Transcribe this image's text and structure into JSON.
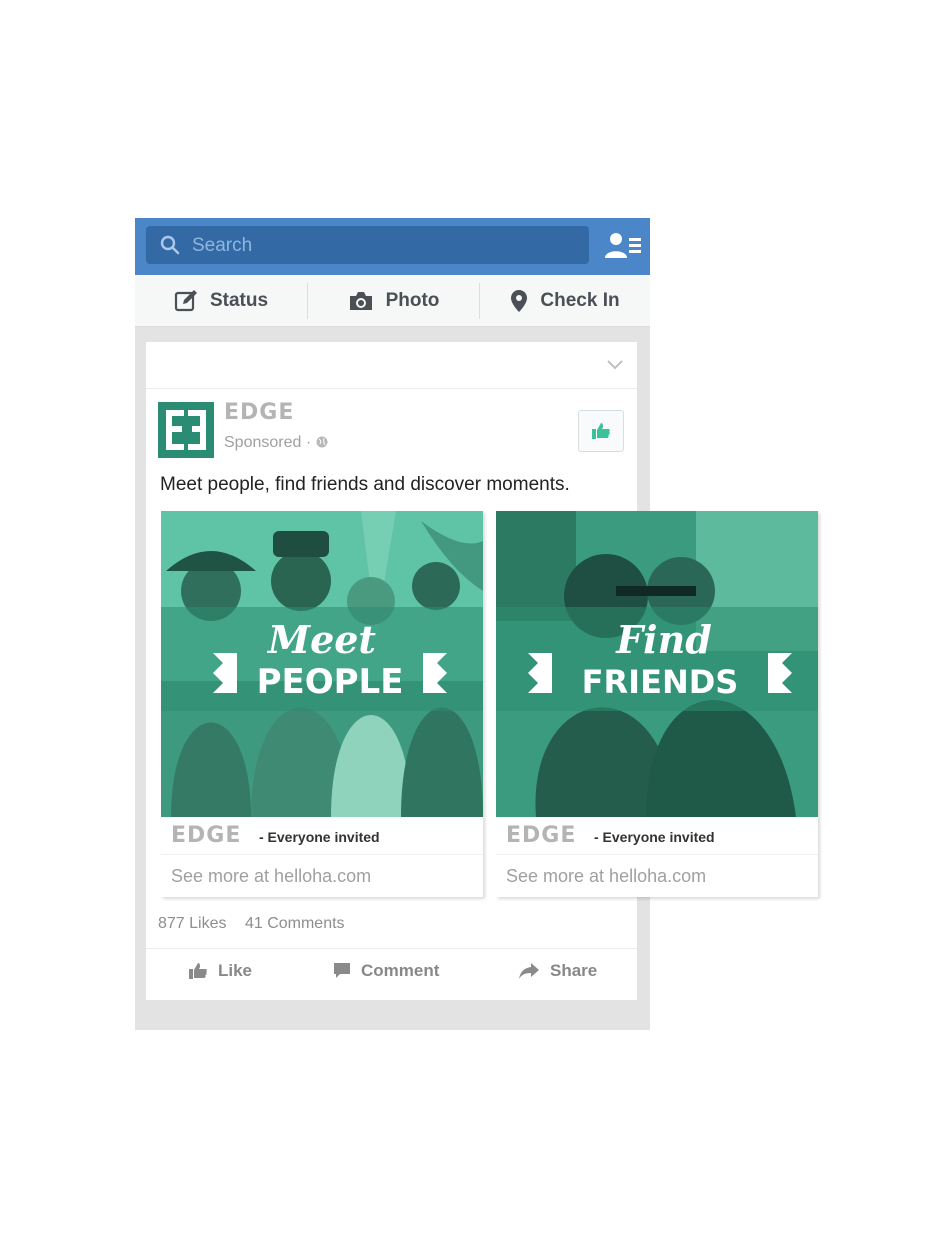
{
  "topbar": {
    "search_placeholder": "Search",
    "icons": [
      "search-icon",
      "friend-requests-icon"
    ],
    "color": "#4a86c8"
  },
  "actions": [
    {
      "label": "Status",
      "icon": "edit-icon"
    },
    {
      "label": "Photo",
      "icon": "camera-icon"
    },
    {
      "label": "Check In",
      "icon": "location-pin-icon"
    }
  ],
  "post": {
    "page_name": "EDGE",
    "sponsored": "Sponsored",
    "separator": "·",
    "caption": "Meet people, find friends and discover moments.",
    "likes": "877 Likes",
    "comments": "41 Comments",
    "accent": "#2a9a7a"
  },
  "carousel": [
    {
      "headline_script": "Meet",
      "headline_block": "PEOPLE",
      "brand": "EDGE",
      "tagline": "- Everyone invited",
      "link": "See more at helloha.com"
    },
    {
      "headline_script": "Find",
      "headline_block": "FRIENDS",
      "brand": "EDGE",
      "tagline": "- Everyone invited",
      "link": "See more at helloha.com"
    }
  ],
  "footer": [
    {
      "label": "Like",
      "icon": "thumbs-up-icon"
    },
    {
      "label": "Comment",
      "icon": "comment-icon"
    },
    {
      "label": "Share",
      "icon": "share-arrow-icon"
    }
  ]
}
